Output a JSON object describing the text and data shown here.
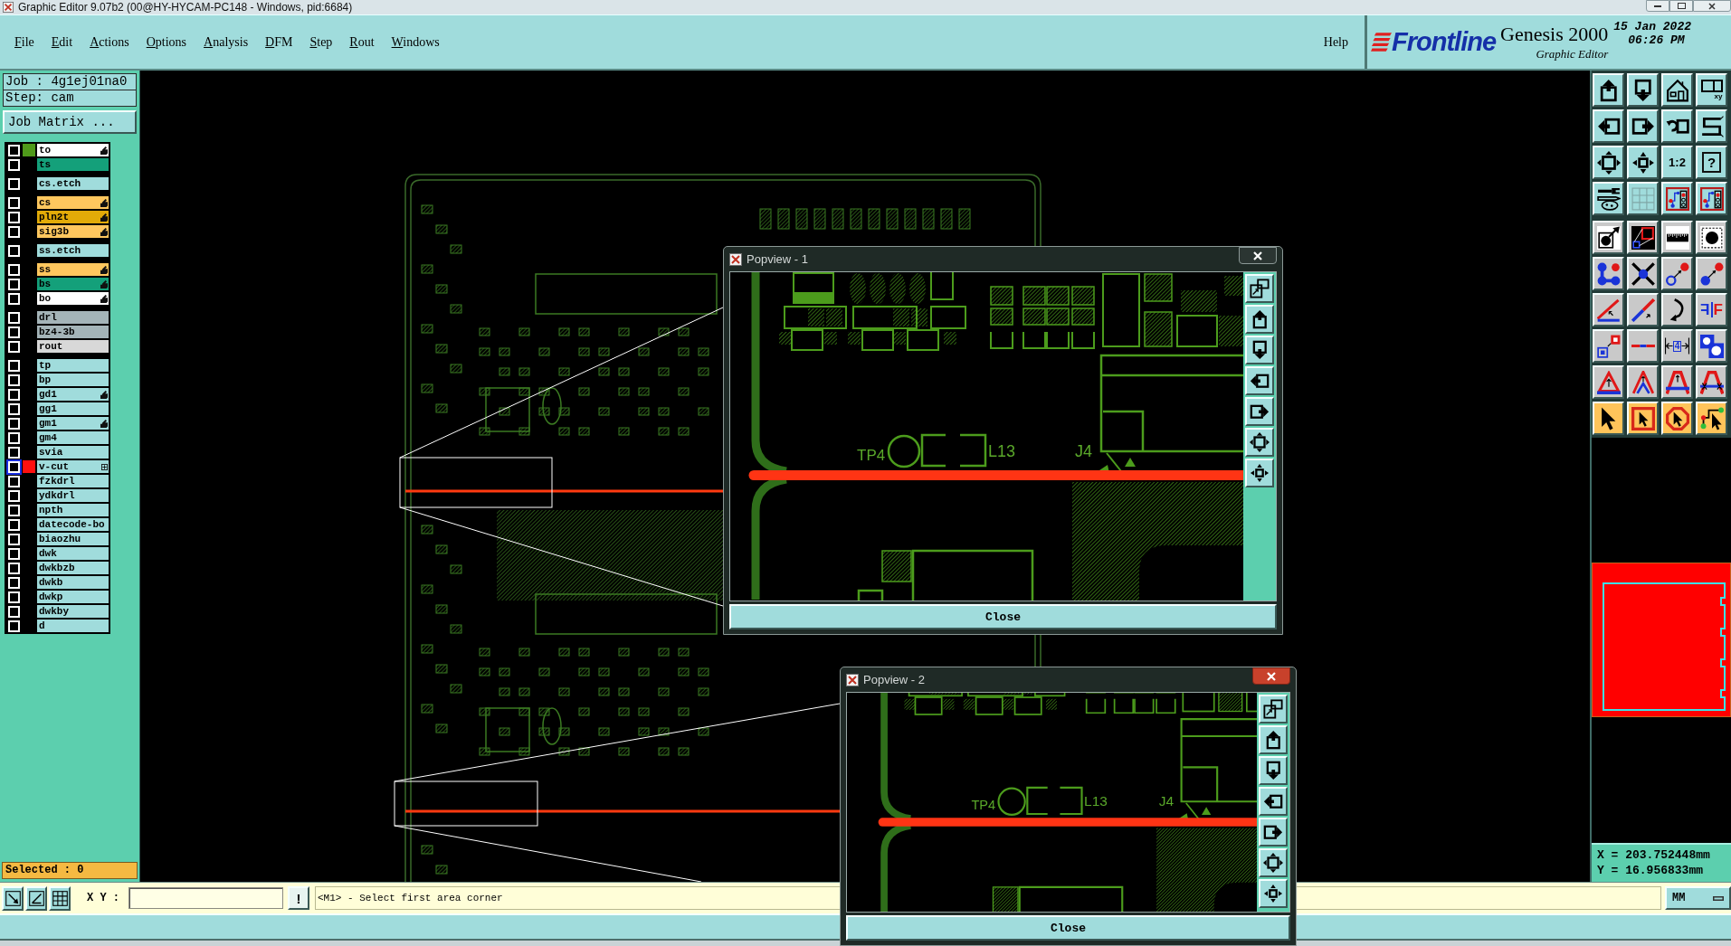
{
  "window": {
    "title": "Graphic Editor 9.07b2 (00@HY-HYCAM-PC148 - Windows, pid:6684)"
  },
  "menu": [
    "File",
    "Edit",
    "Actions",
    "Options",
    "Analysis",
    "DFM",
    "Step",
    "Rout",
    "Windows"
  ],
  "help_menu": "Help",
  "brand": {
    "logo": "Frontline",
    "product": "Genesis 2000",
    "subtitle": "Graphic Editor",
    "date": "15 Jan 2022",
    "time": "06:26 PM"
  },
  "job": {
    "name": "Job : 4g1ej01na0",
    "step": "Step: cam",
    "matrix_button": "Job Matrix ..."
  },
  "layer_groups": [
    {
      "layers": [
        {
          "name": "to",
          "color": "#ffffff",
          "swatch": {
            "color": "#4f9a1a"
          },
          "checked": false,
          "selected": false,
          "affected": true,
          "flagged": false
        },
        {
          "name": "ts",
          "color": "#14a07a",
          "checked": false,
          "selected": false,
          "affected": false,
          "flagged": false
        }
      ]
    },
    {
      "layers": [
        {
          "name": "cs.etch",
          "color": "#a0dcdc",
          "checked": false,
          "selected": false,
          "affected": false,
          "flagged": false
        }
      ]
    },
    {
      "layers": [
        {
          "name": "cs",
          "color": "#ffc75e",
          "checked": false,
          "selected": false,
          "affected": true,
          "flagged": false
        },
        {
          "name": "pln2t",
          "color": "#e2ab08",
          "checked": false,
          "selected": false,
          "affected": true,
          "flagged": false
        },
        {
          "name": "sig3b",
          "color": "#ffc75e",
          "checked": false,
          "selected": false,
          "affected": true,
          "flagged": false
        }
      ]
    },
    {
      "layers": [
        {
          "name": "ss.etch",
          "color": "#a0dcdc",
          "checked": false,
          "selected": false,
          "affected": false,
          "flagged": false
        }
      ]
    },
    {
      "layers": [
        {
          "name": "ss",
          "color": "#ffc75e",
          "checked": false,
          "selected": false,
          "affected": true,
          "flagged": false
        },
        {
          "name": "bs",
          "color": "#14a07a",
          "checked": false,
          "selected": false,
          "affected": true,
          "flagged": false
        },
        {
          "name": "bo",
          "color": "#ffffff",
          "checked": false,
          "selected": false,
          "affected": true,
          "flagged": false
        }
      ]
    },
    {
      "layers": [
        {
          "name": "drl",
          "color": "#a4b4b8",
          "checked": false,
          "selected": false,
          "affected": false,
          "flagged": false
        },
        {
          "name": "bz4-3b",
          "color": "#a4b4b8",
          "checked": false,
          "selected": false,
          "affected": false,
          "flagged": false
        },
        {
          "name": "rout",
          "color": "#d8d8d8",
          "checked": false,
          "selected": false,
          "affected": false,
          "flagged": false
        }
      ]
    },
    {
      "layers": [
        {
          "name": "tp",
          "color": "#a0dcdc",
          "checked": false,
          "selected": false,
          "affected": false,
          "flagged": false
        },
        {
          "name": "bp",
          "color": "#a0dcdc",
          "checked": false,
          "selected": false,
          "affected": false,
          "flagged": false
        },
        {
          "name": "gd1",
          "color": "#a0dcdc",
          "checked": false,
          "selected": false,
          "affected": true,
          "flagged": false
        },
        {
          "name": "gg1",
          "color": "#a0dcdc",
          "checked": false,
          "selected": false,
          "affected": false,
          "flagged": false
        },
        {
          "name": "gm1",
          "color": "#a0dcdc",
          "checked": false,
          "selected": false,
          "affected": true,
          "flagged": false
        },
        {
          "name": "gm4",
          "color": "#a0dcdc",
          "checked": false,
          "selected": false,
          "affected": false,
          "flagged": false
        },
        {
          "name": "svia",
          "color": "#a0dcdc",
          "checked": false,
          "selected": false,
          "affected": false,
          "flagged": false
        },
        {
          "name": "v-cut",
          "color": "#a0dcdc",
          "swatch": {
            "color": "#ff1010"
          },
          "checked": false,
          "selected": true,
          "affected": false,
          "flagged": true
        },
        {
          "name": "fzkdrl",
          "color": "#a0dcdc",
          "checked": false,
          "selected": false,
          "affected": false,
          "flagged": false
        },
        {
          "name": "ydkdrl",
          "color": "#a0dcdc",
          "checked": false,
          "selected": false,
          "affected": false,
          "flagged": false
        },
        {
          "name": "npth",
          "color": "#a0dcdc",
          "checked": false,
          "selected": false,
          "affected": false,
          "flagged": false
        },
        {
          "name": "datecode-bo",
          "color": "#a0dcdc",
          "checked": false,
          "selected": false,
          "affected": false,
          "flagged": false
        },
        {
          "name": "biaozhu",
          "color": "#a0dcdc",
          "checked": false,
          "selected": false,
          "affected": false,
          "flagged": false
        },
        {
          "name": "dwk",
          "color": "#a0dcdc",
          "checked": false,
          "selected": false,
          "affected": false,
          "flagged": false
        },
        {
          "name": "dwkbzb",
          "color": "#a0dcdc",
          "checked": false,
          "selected": false,
          "affected": false,
          "flagged": false
        },
        {
          "name": "dwkb",
          "color": "#a0dcdc",
          "checked": false,
          "selected": false,
          "affected": false,
          "flagged": false
        },
        {
          "name": "dwkp",
          "color": "#a0dcdc",
          "checked": false,
          "selected": false,
          "affected": false,
          "flagged": false
        },
        {
          "name": "dwkby",
          "color": "#a0dcdc",
          "checked": false,
          "selected": false,
          "affected": false,
          "flagged": false
        },
        {
          "name": "d",
          "color": "#a0dcdc",
          "checked": false,
          "selected": false,
          "affected": false,
          "flagged": false
        }
      ]
    }
  ],
  "selected_count": "Selected : 0",
  "toolbar_sections": [
    {
      "kind": "view",
      "buttons": [
        {
          "kind": "up"
        },
        {
          "kind": "down"
        },
        {
          "kind": "home"
        },
        {
          "kind": "window",
          "label": "xy"
        },
        {
          "kind": "left"
        },
        {
          "kind": "right"
        },
        {
          "kind": "undo"
        },
        {
          "kind": "snake"
        },
        {
          "kind": "expand"
        },
        {
          "kind": "shrink"
        },
        {
          "kind": "ratio",
          "label": "1:2"
        },
        {
          "kind": "help",
          "label": "?"
        },
        {
          "kind": "tools"
        },
        {
          "kind": "grid"
        },
        {
          "kind": "circuit"
        },
        {
          "kind": "circuit"
        }
      ]
    },
    {
      "kind": "edit",
      "buttons": [
        {
          "kind": "pad"
        },
        {
          "kind": "zoom"
        },
        {
          "kind": "ruler"
        },
        {
          "kind": "dashed"
        },
        {
          "kind": "nodes"
        },
        {
          "kind": "cross"
        },
        {
          "kind": "ring"
        },
        {
          "kind": "dot"
        },
        {
          "kind": "angle"
        },
        {
          "kind": "diagonal"
        },
        {
          "kind": "curve"
        },
        {
          "kind": "mirror",
          "mirrored_label": "F",
          "label": "F"
        },
        {
          "kind": "move"
        },
        {
          "kind": "split"
        },
        {
          "kind": "measure",
          "label": "4"
        },
        {
          "kind": "holes"
        },
        {
          "kind": "triangle"
        },
        {
          "kind": "chevron"
        },
        {
          "kind": "arch"
        },
        {
          "kind": "bridge"
        }
      ]
    },
    {
      "kind": "select",
      "buttons": [
        {
          "kind": "pointer"
        },
        {
          "kind": "frame"
        },
        {
          "kind": "octagon"
        },
        {
          "kind": "route"
        }
      ]
    }
  ],
  "coordinates": {
    "x": "X = 203.752448mm",
    "y": "Y = 16.956833mm"
  },
  "command_line": {
    "tools": [
      {
        "kind": "diagonalbox"
      },
      {
        "kind": "anglebox"
      },
      {
        "kind": "gridbox"
      }
    ],
    "label": "X Y :",
    "alert_button": "!",
    "message": "<M1> - Select first area corner",
    "units": "MM"
  },
  "popviews": [
    {
      "title": "Popview - 1",
      "close_highlighted": false,
      "labels": [
        "TP4",
        "L13",
        "J4"
      ],
      "tools": [
        {
          "kind": "popout"
        },
        {
          "kind": "up"
        },
        {
          "kind": "down"
        },
        {
          "kind": "left"
        },
        {
          "kind": "right"
        },
        {
          "kind": "expand"
        },
        {
          "kind": "shrink"
        }
      ],
      "button": "Close"
    },
    {
      "title": "Popview - 2",
      "close_highlighted": true,
      "labels": [
        "TP4",
        "L13",
        "J4"
      ],
      "tools": [
        {
          "kind": "popout"
        },
        {
          "kind": "up"
        },
        {
          "kind": "down"
        },
        {
          "kind": "left"
        },
        {
          "kind": "right"
        },
        {
          "kind": "expand"
        },
        {
          "kind": "shrink"
        }
      ],
      "button": "Close"
    }
  ]
}
